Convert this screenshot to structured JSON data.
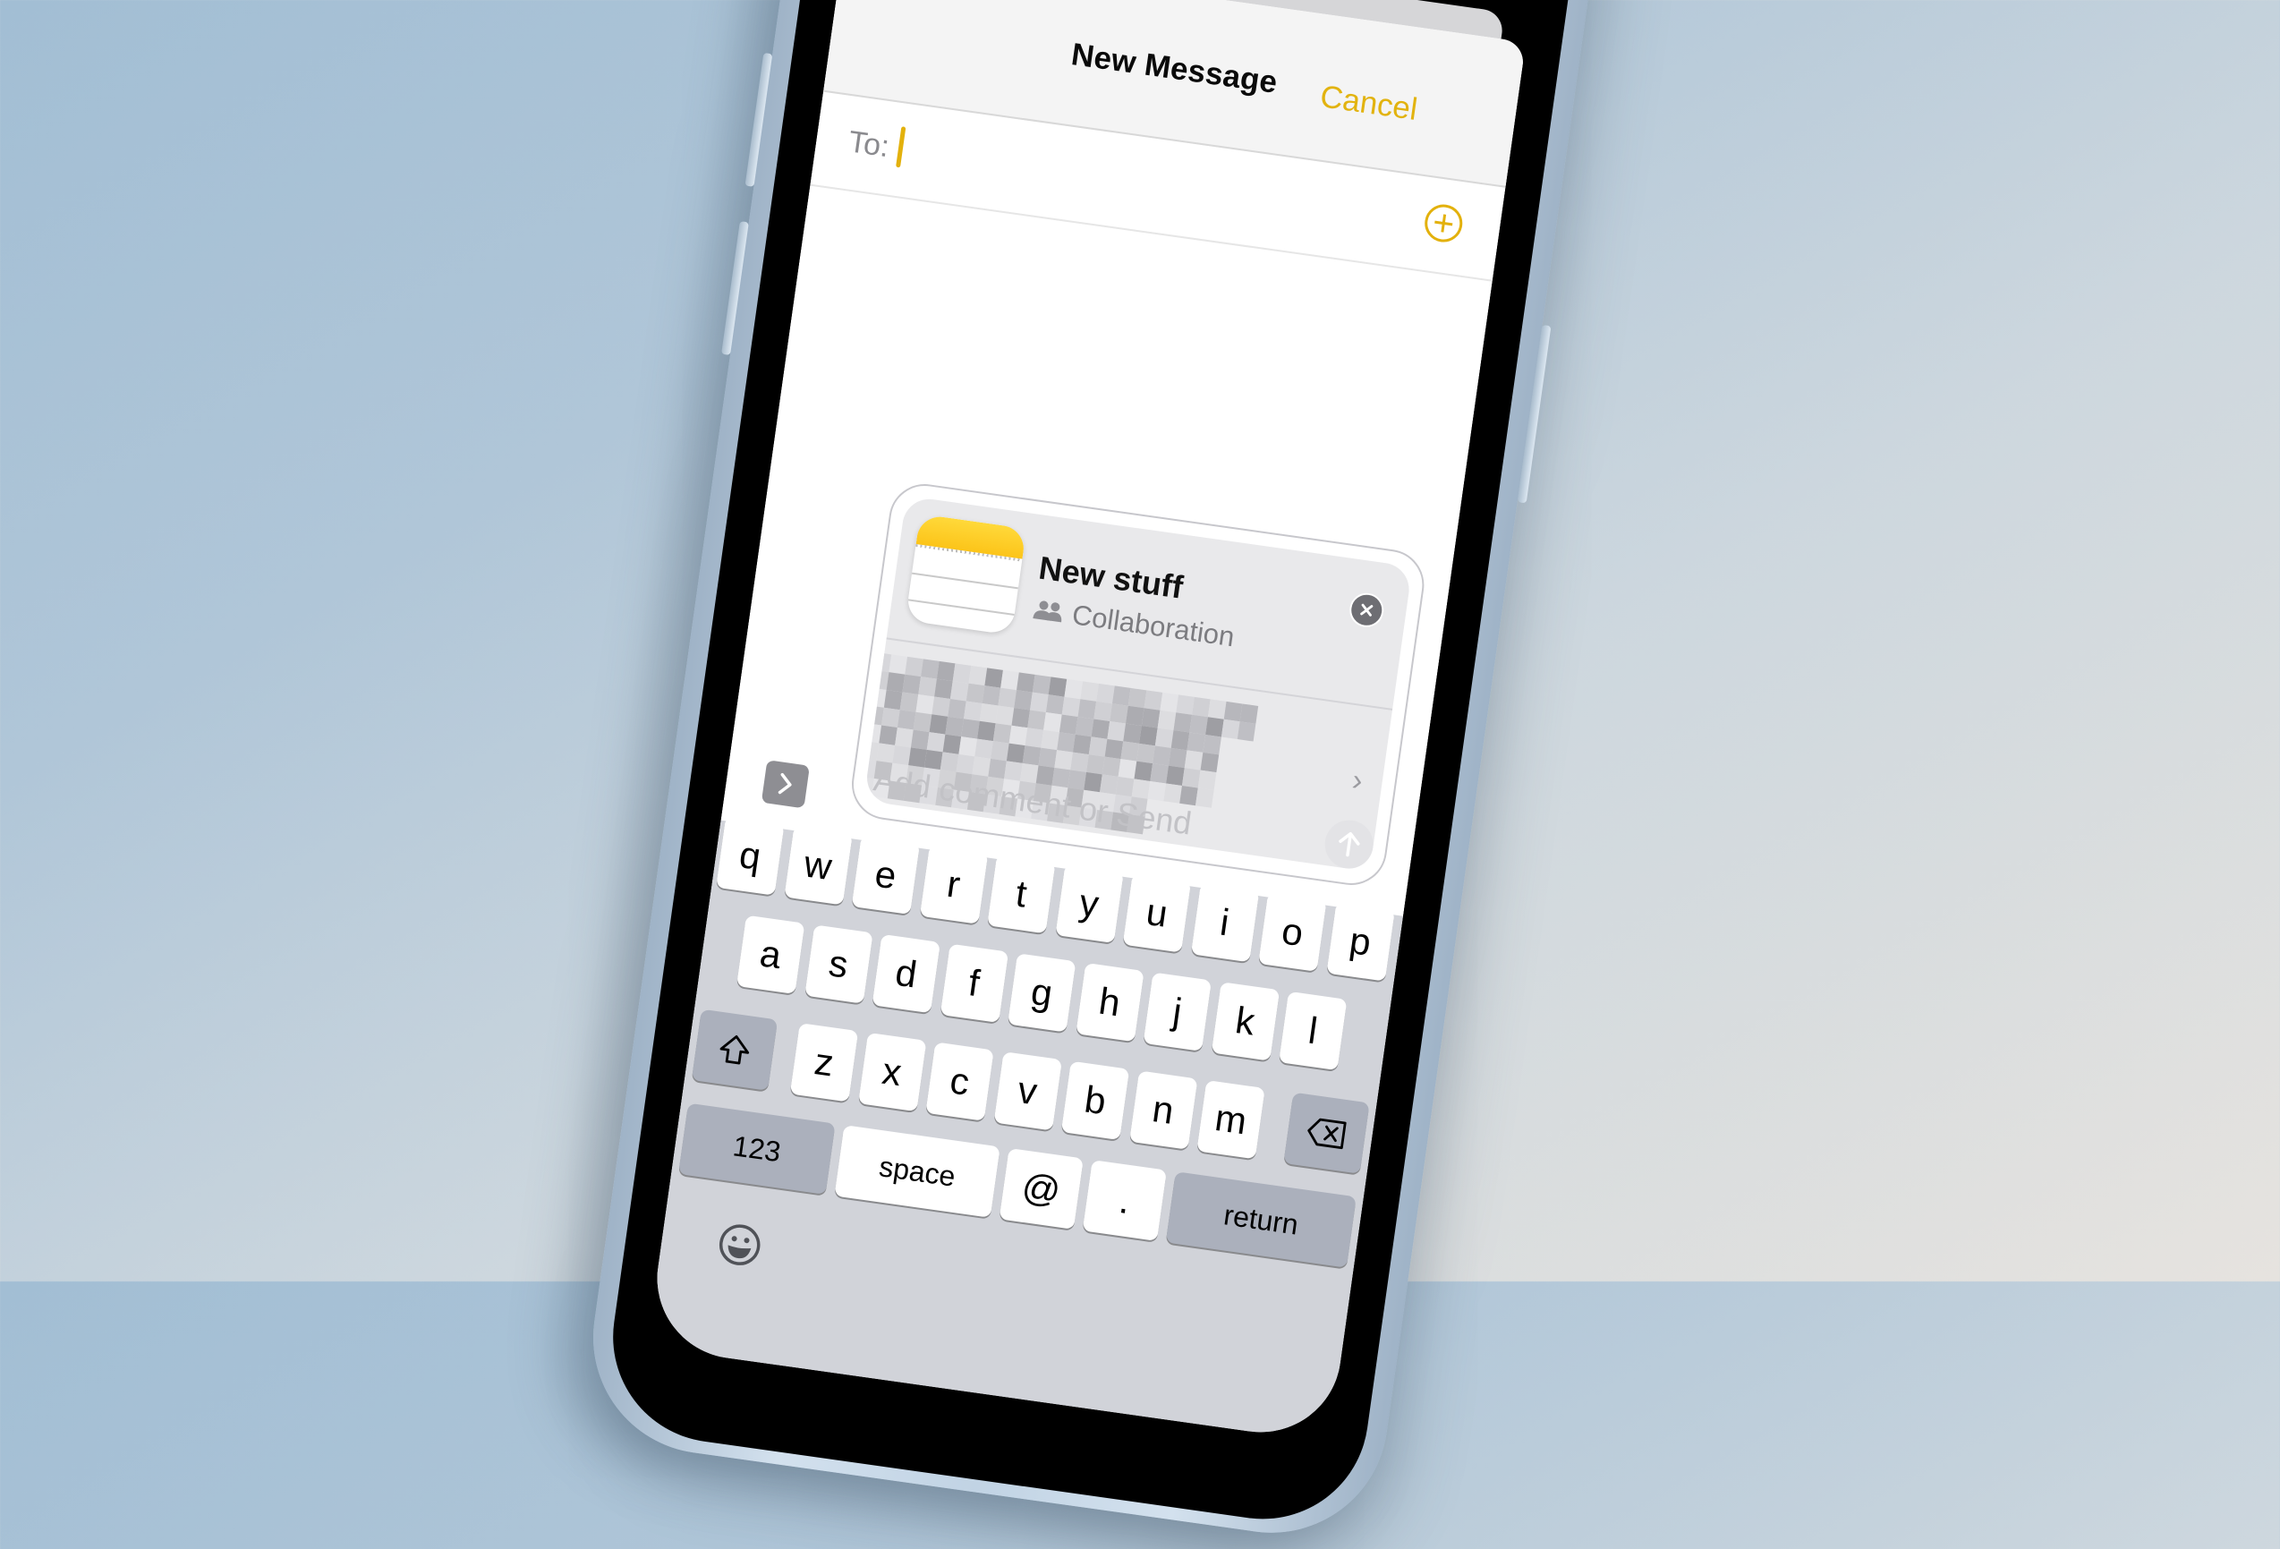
{
  "app": "Messages",
  "colors": {
    "accent": "#e3b10c",
    "header_bg": "#f4f4f4",
    "keyboard_bg": "#d1d3d9",
    "dark_key": "#abb0bc",
    "background_top_left": "#a2bed4",
    "background_bottom_right": "#e6e3df"
  },
  "header": {
    "title": "New Message",
    "cancel_label": "Cancel"
  },
  "recipient": {
    "label": "To:",
    "value": "",
    "add_contact_icon": "plus-circle-icon"
  },
  "composer": {
    "expand_icon": "chevron-right-icon",
    "link_card": {
      "title": "New stuff",
      "subtitle": "Collaboration",
      "subtitle_icon": "people-icon",
      "app_icon": "notes-app-icon",
      "close_icon": "close-icon",
      "preview_text": "[redacted]",
      "chevron": "›"
    },
    "placeholder": "Add comment or Send",
    "send_icon": "arrow-up-icon"
  },
  "keyboard": {
    "row1": [
      "q",
      "w",
      "e",
      "r",
      "t",
      "y",
      "u",
      "i",
      "o",
      "p"
    ],
    "row2": [
      "a",
      "s",
      "d",
      "f",
      "g",
      "h",
      "j",
      "k",
      "l"
    ],
    "row3": [
      "z",
      "x",
      "c",
      "v",
      "b",
      "n",
      "m"
    ],
    "shift_icon": "shift-icon",
    "delete_icon": "delete-icon",
    "numbers_label": "123",
    "space_label": "space",
    "at_label": "@",
    "period_label": ".",
    "return_label": "return",
    "emoji_icon": "emoji-icon"
  }
}
